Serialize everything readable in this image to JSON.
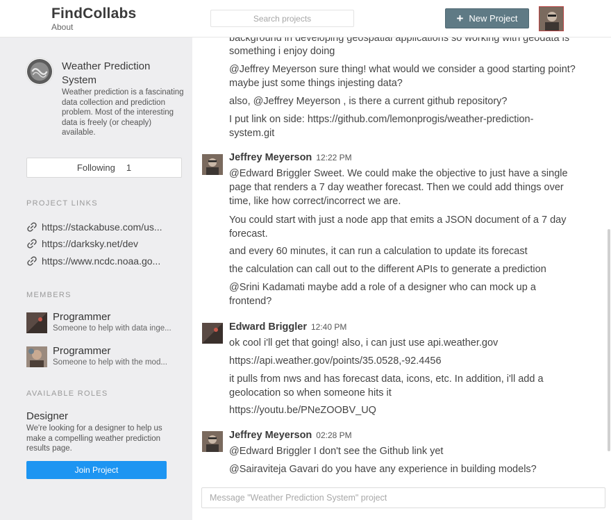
{
  "header": {
    "brand": "FindCollabs",
    "about": "About",
    "search_placeholder": "Search projects",
    "new_project_label": "New Project"
  },
  "sidebar": {
    "project_title": "Weather Prediction System",
    "project_description": "Weather prediction is a fascinating data collection and prediction problem. Most of the interesting data is freely (or cheaply) available.",
    "following_label": "Following",
    "following_count": "1",
    "links_heading": "PROJECT LINKS",
    "links": [
      "https://stackabuse.com/us...",
      "https://darksky.net/dev",
      "https://www.ncdc.noaa.go..."
    ],
    "members_heading": "MEMBERS",
    "members": [
      {
        "name": "Programmer",
        "role": "Someone to help with data inge..."
      },
      {
        "name": "Programmer",
        "role": "Someone to help with the mod..."
      }
    ],
    "roles_heading": "AVAILABLE ROLES",
    "role_name": "Designer",
    "role_description": "We're looking for a designer to help us make a compelling weather prediction results page.",
    "join_label": "Join Project"
  },
  "chat": {
    "top_lines": [
      "background in developing geospatial applications so working with geodata is",
      "something i enjoy doing",
      "@Jeffrey Meyerson sure thing! what would we consider a good starting point?",
      "maybe just some things injesting data?",
      "also, @Jeffrey Meyerson , is there a current github repository?",
      "I put link on side: https://github.com/lemonprogis/weather-prediction-",
      "system.git"
    ],
    "messages": [
      {
        "author": "Jeffrey Meyerson",
        "time": "12:22 PM",
        "lines": [
          "@Edward Briggler Sweet. We could make the objective to just have a single",
          "page that renders a 7 day weather forecast. Then we could add things over",
          "time, like how correct/incorrect we are.",
          "You could start with just a node app that emits a JSON document of a 7 day",
          "forecast.",
          "and every 60 minutes, it can run a calculation to update its forecast",
          "the calculation can call out to the different APIs to generate a prediction",
          "@Srini Kadamati maybe add a role of a designer who can mock up a",
          "frontend?"
        ]
      },
      {
        "author": "Edward Briggler",
        "time": "12:40 PM",
        "lines": [
          "ok cool i'll get that going! also, i can just use api.weather.gov",
          "https://api.weather.gov/points/35.0528,-92.4456",
          "it pulls from nws and has forecast data, icons, etc. In addition, i'll add a",
          "geolocation so when someone hits it",
          "https://youtu.be/PNeZOOBV_UQ"
        ]
      },
      {
        "author": "Jeffrey Meyerson",
        "time": "02:28 PM",
        "lines": [
          "@Edward Briggler I don't see the Github link yet",
          "@Sairaviteja Gavari do you have any experience in building models?"
        ]
      }
    ],
    "composer_placeholder": "Message \"Weather Prediction System\" project"
  },
  "colors": {
    "sidebar_bg": "#eeeef0",
    "new_project_bg": "#5f7a85",
    "join_bg": "#1d95f2"
  },
  "icons": [
    "plus-icon",
    "link-icon",
    "user-avatar",
    "project-logo-icon"
  ]
}
